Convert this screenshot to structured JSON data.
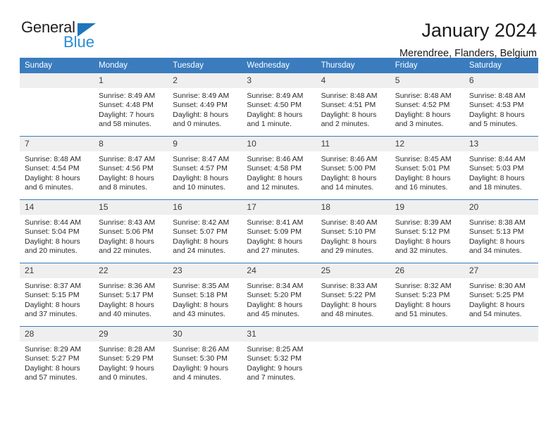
{
  "logo": {
    "word_dark": "General",
    "word_blue": "Blue",
    "triangle_color": "#1f76bd",
    "blue_color": "#2b8cd4"
  },
  "header": {
    "title": "January 2024",
    "subtitle": "Merendree, Flanders, Belgium"
  },
  "theme": {
    "header_row_bg": "#3a7cbe",
    "daynum_bg": "#efefef",
    "grid_line": "#3a7cbe"
  },
  "weekday_headers": [
    "Sunday",
    "Monday",
    "Tuesday",
    "Wednesday",
    "Thursday",
    "Friday",
    "Saturday"
  ],
  "weeks": [
    [
      {
        "day": "",
        "lines": []
      },
      {
        "day": "1",
        "lines": [
          "Sunrise: 8:49 AM",
          "Sunset: 4:48 PM",
          "Daylight: 7 hours",
          "and 58 minutes."
        ]
      },
      {
        "day": "2",
        "lines": [
          "Sunrise: 8:49 AM",
          "Sunset: 4:49 PM",
          "Daylight: 8 hours",
          "and 0 minutes."
        ]
      },
      {
        "day": "3",
        "lines": [
          "Sunrise: 8:49 AM",
          "Sunset: 4:50 PM",
          "Daylight: 8 hours",
          "and 1 minute."
        ]
      },
      {
        "day": "4",
        "lines": [
          "Sunrise: 8:48 AM",
          "Sunset: 4:51 PM",
          "Daylight: 8 hours",
          "and 2 minutes."
        ]
      },
      {
        "day": "5",
        "lines": [
          "Sunrise: 8:48 AM",
          "Sunset: 4:52 PM",
          "Daylight: 8 hours",
          "and 3 minutes."
        ]
      },
      {
        "day": "6",
        "lines": [
          "Sunrise: 8:48 AM",
          "Sunset: 4:53 PM",
          "Daylight: 8 hours",
          "and 5 minutes."
        ]
      }
    ],
    [
      {
        "day": "7",
        "lines": [
          "Sunrise: 8:48 AM",
          "Sunset: 4:54 PM",
          "Daylight: 8 hours",
          "and 6 minutes."
        ]
      },
      {
        "day": "8",
        "lines": [
          "Sunrise: 8:47 AM",
          "Sunset: 4:56 PM",
          "Daylight: 8 hours",
          "and 8 minutes."
        ]
      },
      {
        "day": "9",
        "lines": [
          "Sunrise: 8:47 AM",
          "Sunset: 4:57 PM",
          "Daylight: 8 hours",
          "and 10 minutes."
        ]
      },
      {
        "day": "10",
        "lines": [
          "Sunrise: 8:46 AM",
          "Sunset: 4:58 PM",
          "Daylight: 8 hours",
          "and 12 minutes."
        ]
      },
      {
        "day": "11",
        "lines": [
          "Sunrise: 8:46 AM",
          "Sunset: 5:00 PM",
          "Daylight: 8 hours",
          "and 14 minutes."
        ]
      },
      {
        "day": "12",
        "lines": [
          "Sunrise: 8:45 AM",
          "Sunset: 5:01 PM",
          "Daylight: 8 hours",
          "and 16 minutes."
        ]
      },
      {
        "day": "13",
        "lines": [
          "Sunrise: 8:44 AM",
          "Sunset: 5:03 PM",
          "Daylight: 8 hours",
          "and 18 minutes."
        ]
      }
    ],
    [
      {
        "day": "14",
        "lines": [
          "Sunrise: 8:44 AM",
          "Sunset: 5:04 PM",
          "Daylight: 8 hours",
          "and 20 minutes."
        ]
      },
      {
        "day": "15",
        "lines": [
          "Sunrise: 8:43 AM",
          "Sunset: 5:06 PM",
          "Daylight: 8 hours",
          "and 22 minutes."
        ]
      },
      {
        "day": "16",
        "lines": [
          "Sunrise: 8:42 AM",
          "Sunset: 5:07 PM",
          "Daylight: 8 hours",
          "and 24 minutes."
        ]
      },
      {
        "day": "17",
        "lines": [
          "Sunrise: 8:41 AM",
          "Sunset: 5:09 PM",
          "Daylight: 8 hours",
          "and 27 minutes."
        ]
      },
      {
        "day": "18",
        "lines": [
          "Sunrise: 8:40 AM",
          "Sunset: 5:10 PM",
          "Daylight: 8 hours",
          "and 29 minutes."
        ]
      },
      {
        "day": "19",
        "lines": [
          "Sunrise: 8:39 AM",
          "Sunset: 5:12 PM",
          "Daylight: 8 hours",
          "and 32 minutes."
        ]
      },
      {
        "day": "20",
        "lines": [
          "Sunrise: 8:38 AM",
          "Sunset: 5:13 PM",
          "Daylight: 8 hours",
          "and 34 minutes."
        ]
      }
    ],
    [
      {
        "day": "21",
        "lines": [
          "Sunrise: 8:37 AM",
          "Sunset: 5:15 PM",
          "Daylight: 8 hours",
          "and 37 minutes."
        ]
      },
      {
        "day": "22",
        "lines": [
          "Sunrise: 8:36 AM",
          "Sunset: 5:17 PM",
          "Daylight: 8 hours",
          "and 40 minutes."
        ]
      },
      {
        "day": "23",
        "lines": [
          "Sunrise: 8:35 AM",
          "Sunset: 5:18 PM",
          "Daylight: 8 hours",
          "and 43 minutes."
        ]
      },
      {
        "day": "24",
        "lines": [
          "Sunrise: 8:34 AM",
          "Sunset: 5:20 PM",
          "Daylight: 8 hours",
          "and 45 minutes."
        ]
      },
      {
        "day": "25",
        "lines": [
          "Sunrise: 8:33 AM",
          "Sunset: 5:22 PM",
          "Daylight: 8 hours",
          "and 48 minutes."
        ]
      },
      {
        "day": "26",
        "lines": [
          "Sunrise: 8:32 AM",
          "Sunset: 5:23 PM",
          "Daylight: 8 hours",
          "and 51 minutes."
        ]
      },
      {
        "day": "27",
        "lines": [
          "Sunrise: 8:30 AM",
          "Sunset: 5:25 PM",
          "Daylight: 8 hours",
          "and 54 minutes."
        ]
      }
    ],
    [
      {
        "day": "28",
        "lines": [
          "Sunrise: 8:29 AM",
          "Sunset: 5:27 PM",
          "Daylight: 8 hours",
          "and 57 minutes."
        ]
      },
      {
        "day": "29",
        "lines": [
          "Sunrise: 8:28 AM",
          "Sunset: 5:29 PM",
          "Daylight: 9 hours",
          "and 0 minutes."
        ]
      },
      {
        "day": "30",
        "lines": [
          "Sunrise: 8:26 AM",
          "Sunset: 5:30 PM",
          "Daylight: 9 hours",
          "and 4 minutes."
        ]
      },
      {
        "day": "31",
        "lines": [
          "Sunrise: 8:25 AM",
          "Sunset: 5:32 PM",
          "Daylight: 9 hours",
          "and 7 minutes."
        ]
      },
      {
        "day": "",
        "lines": []
      },
      {
        "day": "",
        "lines": []
      },
      {
        "day": "",
        "lines": []
      }
    ]
  ]
}
